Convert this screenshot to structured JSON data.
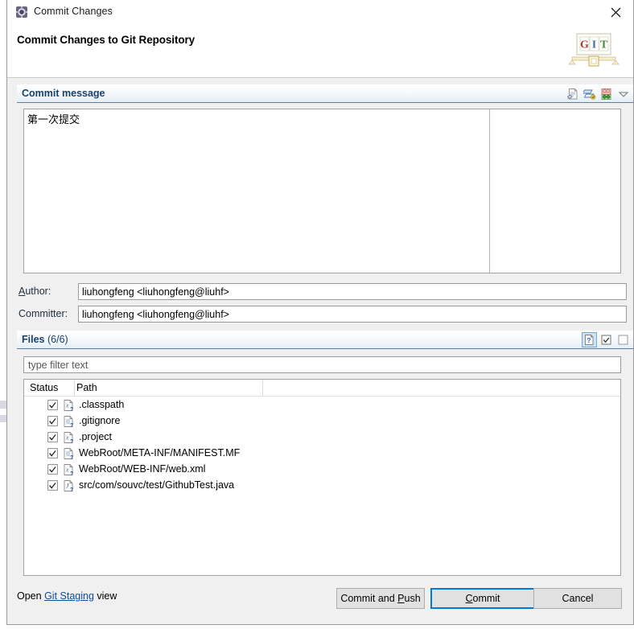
{
  "window": {
    "icon": "commit-changes-icon",
    "title": "Commit Changes",
    "close_label": "✕"
  },
  "header": {
    "title": "Commit Changes to Git Repository",
    "logo_alt": "GIT",
    "logo_text": "GIT"
  },
  "commit_message": {
    "section_label": "Commit message",
    "text": "第一次提交",
    "tools": [
      {
        "name": "add-signed-off-by-icon",
        "tooltip": "Add Signed-off-by"
      },
      {
        "name": "add-change-id-icon",
        "tooltip": "Add Change-Id"
      },
      {
        "name": "amend-previous-commit-icon",
        "tooltip": "Amend previous commit"
      },
      {
        "name": "chevron-down-icon",
        "tooltip": "More"
      }
    ]
  },
  "author": {
    "label_prefix": "",
    "label_mnemonic": "A",
    "label_suffix": "uthor:",
    "label_full": "Author:",
    "value": "liuhongfeng <liuhongfeng@liuhf>"
  },
  "committer": {
    "label_full": "Committer:",
    "value": "liuhongfeng <liuhongfeng@liuhf>"
  },
  "files": {
    "section_label": "Files",
    "count_label": "(6/6)",
    "tools": [
      {
        "name": "show-untracked-files-icon",
        "tooltip": "Show untracked files",
        "selected": true
      },
      {
        "name": "select-all-icon",
        "tooltip": "Select all",
        "selected": false
      },
      {
        "name": "deselect-all-icon",
        "tooltip": "Deselect all",
        "selected": false
      }
    ],
    "filter_placeholder": "type filter text",
    "filter_value": "",
    "columns": [
      "Status",
      "Path"
    ],
    "rows": [
      {
        "checked": true,
        "icon": "xml-file-untracked-icon",
        "path": ".classpath"
      },
      {
        "checked": true,
        "icon": "text-file-untracked-icon",
        "path": ".gitignore"
      },
      {
        "checked": true,
        "icon": "xml-file-untracked-icon",
        "path": ".project"
      },
      {
        "checked": true,
        "icon": "text-file-untracked-icon",
        "path": "WebRoot/META-INF/MANIFEST.MF"
      },
      {
        "checked": true,
        "icon": "xml-file-untracked-icon",
        "path": "WebRoot/WEB-INF/web.xml"
      },
      {
        "checked": true,
        "icon": "java-file-untracked-icon",
        "path": "src/com/souvc/test/GithubTest.java"
      }
    ]
  },
  "footer": {
    "staging_prefix": "Open ",
    "staging_link": "Git Staging",
    "staging_suffix": " view",
    "buttons": {
      "commit_and_push_pre": "Commit and ",
      "commit_and_push_mnemonic": "P",
      "commit_and_push_post": "ush",
      "commit_mnemonic": "C",
      "commit_post": "ommit",
      "cancel": "Cancel"
    }
  },
  "colors": {
    "section_header_text": "#17406b",
    "section_header_rule": "#5a7ea8",
    "link": "#0f4c96",
    "default_button_border": "#0078d7",
    "dialog_bg": "#f0f0f0"
  }
}
